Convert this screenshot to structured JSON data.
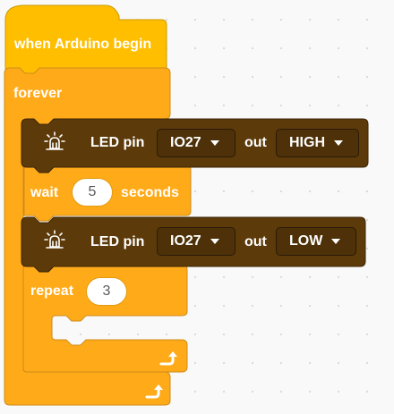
{
  "hat": {
    "label": "when Arduino begin"
  },
  "forever": {
    "label": "forever"
  },
  "led1": {
    "label": "LED pin",
    "pin": "IO27",
    "mid": "out",
    "state": "HIGH"
  },
  "wait": {
    "label": "wait",
    "value": "5",
    "unit": "seconds"
  },
  "led2": {
    "label": "LED pin",
    "pin": "IO27",
    "mid": "out",
    "state": "LOW"
  },
  "repeat": {
    "label": "repeat",
    "value": "3"
  },
  "colors": {
    "control": "#ffab19",
    "control_edge": "#cf8b17",
    "hat": "#ffbf00",
    "hat_edge": "#cc9900",
    "led": "#5c3a0a",
    "led_edge": "#3d2506",
    "workspace": "#f9f9f9"
  },
  "icons": {
    "led": "led-bulb-icon",
    "loop": "loop-arrow-icon"
  }
}
